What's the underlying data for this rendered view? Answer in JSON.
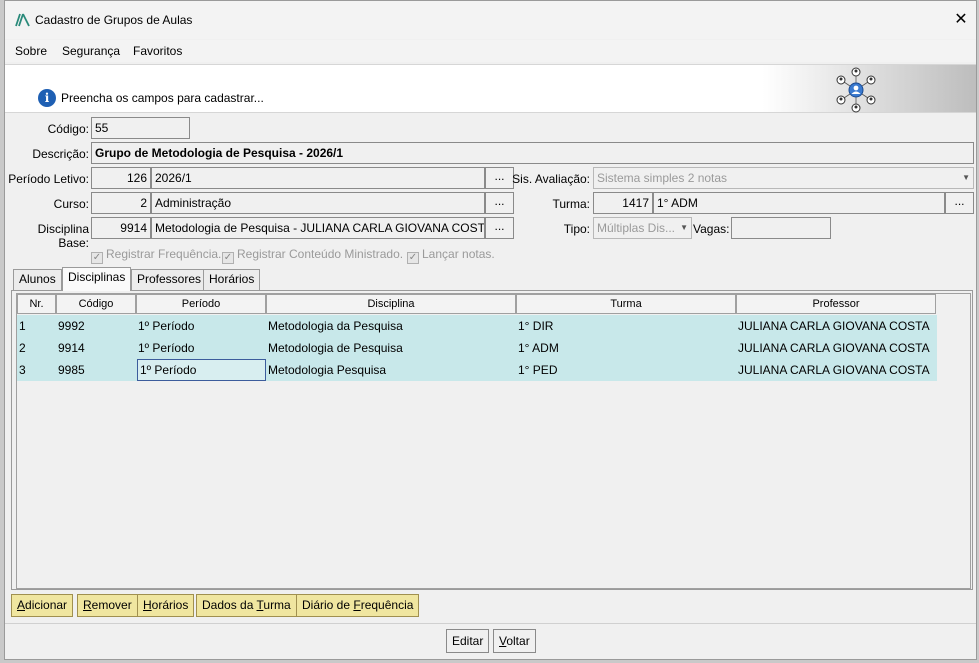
{
  "window": {
    "title": "Cadastro de Grupos de Aulas"
  },
  "menu": {
    "sobre": "Sobre",
    "seguranca": "Segurança",
    "favoritos": "Favoritos"
  },
  "banner": {
    "message": "Preencha os campos para cadastrar..."
  },
  "form": {
    "codigo_label": "Código:",
    "codigo": "55",
    "descricao_label": "Descrição:",
    "descricao": "Grupo de Metodologia de Pesquisa - 2026/1",
    "periodo_label": "Período Letivo:",
    "periodo_id": "126",
    "periodo": "2026/1",
    "sis_label": "Sis. Avaliação:",
    "sis": "Sistema simples 2 notas",
    "curso_label": "Curso:",
    "curso_id": "2",
    "curso": "Administração",
    "turma_label": "Turma:",
    "turma_id": "1417",
    "turma": "1° ADM",
    "disc_label": "Disciplina Base:",
    "disc_id": "9914",
    "disc": "Metodologia de Pesquisa - JULIANA CARLA GIOVANA COSTA",
    "tipo_label": "Tipo:",
    "tipo": "Múltiplas Dis...",
    "vagas_label": "Vagas:",
    "vagas": "",
    "dots": "...",
    "chk_freq": "Registrar Frequência.",
    "chk_cont": "Registrar Conteúdo Ministrado.",
    "chk_notas": "Lançar notas."
  },
  "tabs": [
    "Alunos",
    "Disciplinas",
    "Professores",
    "Horários"
  ],
  "table": {
    "headers": [
      "Nr.",
      "Código",
      "Período",
      "Disciplina",
      "Turma",
      "Professor"
    ],
    "rows": [
      [
        "1",
        "9992",
        "1º Período",
        "Metodologia da Pesquisa",
        "1° DIR",
        "JULIANA CARLA GIOVANA COSTA"
      ],
      [
        "2",
        "9914",
        "1º Período",
        "Metodologia de Pesquisa",
        "1° ADM",
        "JULIANA CARLA GIOVANA COSTA"
      ],
      [
        "3",
        "9985",
        "1º Período",
        "Metodologia Pesquisa",
        "1° PED",
        "JULIANA CARLA GIOVANA COSTA"
      ]
    ]
  },
  "actions": {
    "adicionar_a": "A",
    "adicionar_b": "dicionar",
    "remover_a": "R",
    "remover_b": "emover",
    "horarios_a": "H",
    "horarios_b": "orários",
    "dados_a": "Dados da ",
    "dados_u": "T",
    "dados_b": "urma",
    "diario_a": "Diário de ",
    "diario_u": "F",
    "diario_b": "requência"
  },
  "footer": {
    "editar_a": "Editar",
    "voltar_u": "V",
    "voltar_b": "oltar"
  }
}
